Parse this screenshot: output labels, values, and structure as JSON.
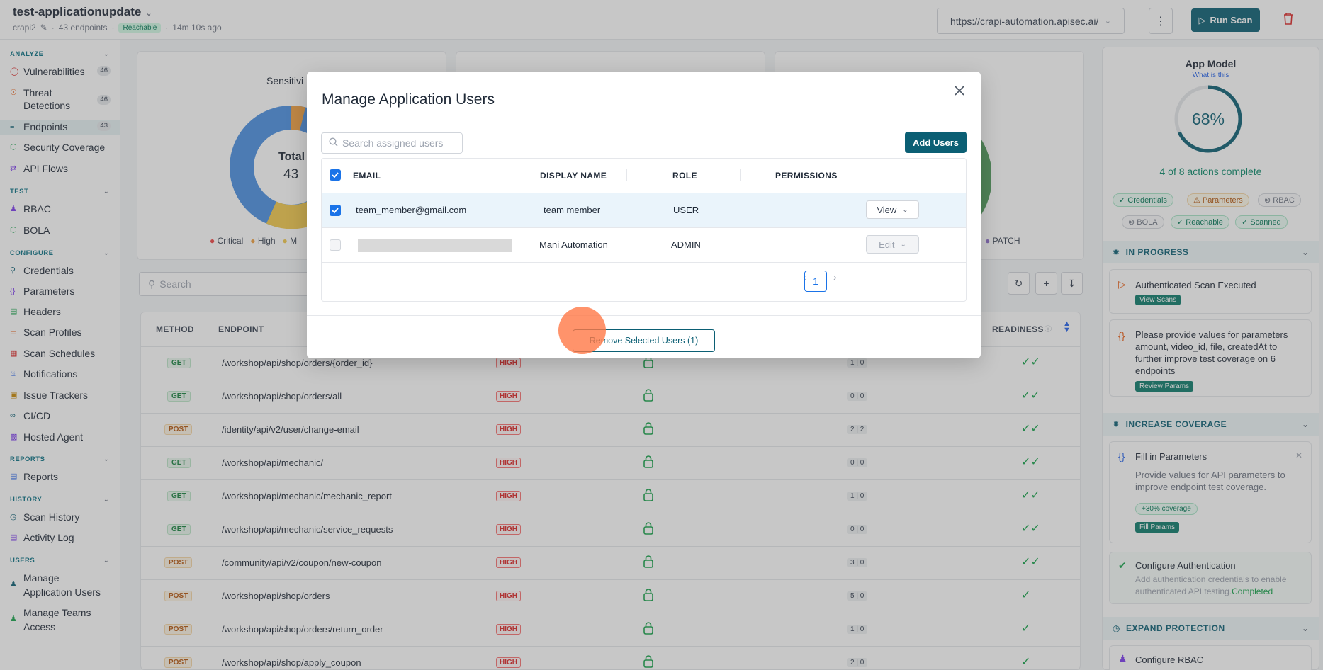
{
  "header": {
    "app_name": "test-applicationupdate",
    "owner": "crapi2",
    "endpoints": "43 endpoints",
    "status": "Reachable",
    "updated": "14m 10s ago",
    "url": "https://crapi-automation.apisec.ai/",
    "run_scan_label": "Run Scan"
  },
  "sidebar": {
    "analyze_label": "ANALYZE",
    "test_label": "TEST",
    "configure_label": "CONFIGURE",
    "reports_label": "REPORTS",
    "history_label": "HISTORY",
    "users_label": "USERS",
    "vulnerabilities": "Vulnerabilities",
    "vulnerabilities_count": "46",
    "threat_detections": "Threat Detections",
    "threat_count": "46",
    "endpoints": "Endpoints",
    "endpoints_count": "43",
    "security_coverage": "Security Coverage",
    "api_flows": "API Flows",
    "rbac": "RBAC",
    "bola": "BOLA",
    "credentials": "Credentials",
    "parameters": "Parameters",
    "headers": "Headers",
    "scan_profiles": "Scan Profiles",
    "scan_schedules": "Scan Schedules",
    "notifications": "Notifications",
    "issue_trackers": "Issue Trackers",
    "cicd": "CI/CD",
    "hosted_agent": "Hosted Agent",
    "reports": "Reports",
    "scan_history": "Scan History",
    "activity_log": "Activity Log",
    "manage_app_users": "Manage Application Users",
    "manage_teams": "Manage Teams Access"
  },
  "charts": {
    "sensitivity_title": "Sensitivi",
    "total_label": "Total",
    "total_value": "43",
    "legend_critical": "Critical",
    "legend_high": "High",
    "legend_m": "M",
    "legend_patch": "PATCH"
  },
  "main": {
    "search_placeholder": "Search",
    "col_method": "METHOD",
    "col_endpoint": "ENDPOINT",
    "col_readiness": "READINESS",
    "rows": [
      {
        "method": "GET",
        "path": "/workshop/api/shop/orders/{order_id}",
        "risk": "HIGH",
        "ratio": "1 | 0"
      },
      {
        "method": "GET",
        "path": "/workshop/api/shop/orders/all",
        "risk": "HIGH",
        "ratio": "0 | 0"
      },
      {
        "method": "POST",
        "path": "/identity/api/v2/user/change-email",
        "risk": "HIGH",
        "ratio": "2 | 2"
      },
      {
        "method": "GET",
        "path": "/workshop/api/mechanic/",
        "risk": "HIGH",
        "ratio": "0 | 0"
      },
      {
        "method": "GET",
        "path": "/workshop/api/mechanic/mechanic_report",
        "risk": "HIGH",
        "ratio": "1 | 0"
      },
      {
        "method": "GET",
        "path": "/workshop/api/mechanic/service_requests",
        "risk": "HIGH",
        "ratio": "0 | 0"
      },
      {
        "method": "POST",
        "path": "/community/api/v2/coupon/new-coupon",
        "risk": "HIGH",
        "ratio": "3 | 0"
      },
      {
        "method": "POST",
        "path": "/workshop/api/shop/orders",
        "risk": "HIGH",
        "ratio": "5 | 0"
      },
      {
        "method": "POST",
        "path": "/workshop/api/shop/orders/return_order",
        "risk": "HIGH",
        "ratio": "1 | 0"
      },
      {
        "method": "POST",
        "path": "/workshop/api/shop/apply_coupon",
        "risk": "HIGH",
        "ratio": "2 | 0"
      }
    ]
  },
  "right_panel": {
    "title": "App Model",
    "what_is": "What is this",
    "percent": "68%",
    "progress": 0.68,
    "actions": "4 of 8 actions complete",
    "chips": [
      "Credentials",
      "Parameters",
      "RBAC",
      "BOLA",
      "Reachable",
      "Scanned"
    ],
    "in_progress": "IN PROGRESS",
    "auth_scan": "Authenticated Scan Executed",
    "view_scans": "View Scans",
    "params_msg": "Please provide values for parameters amount, video_id, file, createdAt to further improve test coverage on 6 endpoints",
    "review_params": "Review Params",
    "increase_coverage": "INCREASE COVERAGE",
    "fill_title": "Fill in Parameters",
    "fill_desc": "Provide values for API parameters to improve endpoint test coverage.",
    "coverage_chip": "+30% coverage",
    "fill_params": "Fill Params",
    "config_auth": "Configure Authentication",
    "config_auth_desc": "Add authentication credentials to enable authenticated API testing.",
    "completed": "Completed",
    "expand_protection": "EXPAND PROTECTION",
    "config_rbac": "Configure RBAC"
  },
  "modal": {
    "title": "Manage Application Users",
    "search_placeholder": "Search assigned users",
    "add_users": "Add Users",
    "col_email": "EMAIL",
    "col_display": "DISPLAY NAME",
    "col_role": "ROLE",
    "col_permissions": "PERMISSIONS",
    "users": [
      {
        "email": "team_member@gmail.com",
        "display": "team member",
        "role": "USER",
        "permission": "View"
      },
      {
        "email": "",
        "display": "Mani Automation",
        "role": "ADMIN",
        "permission": "Edit"
      }
    ],
    "page": "1",
    "remove_label": "Remove Selected Users (1)"
  },
  "colors": {
    "primary": "#0b5f74",
    "checkbox": "#1a73e8",
    "danger": "#dc2626",
    "click_marker": "#ff7846"
  }
}
